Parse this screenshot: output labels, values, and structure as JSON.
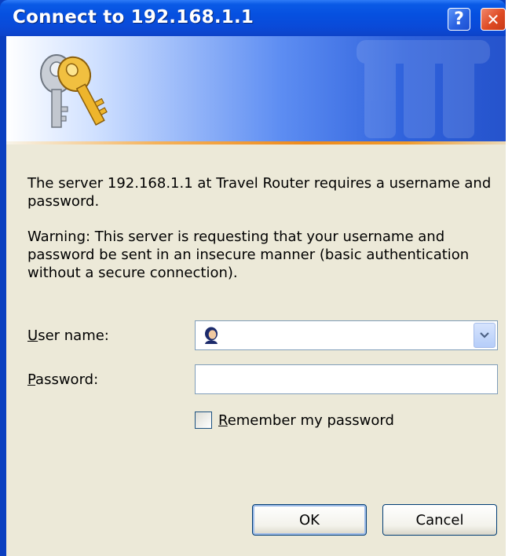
{
  "window": {
    "title": "Connect to 192.168.1.1",
    "help_glyph": "?",
    "close_glyph": "✕"
  },
  "banner": {
    "icon": "keys-icon",
    "watermark": "keys-watermark-icon"
  },
  "message": {
    "server_text": "The server 192.168.1.1 at Travel Router requires a username and password.",
    "warning_text": "Warning: This server is requesting that your username and password be sent in an insecure manner (basic authentication without a secure connection)."
  },
  "form": {
    "username_label_first": "U",
    "username_label_rest": "ser name:",
    "username_value": "",
    "password_label_first": "P",
    "password_label_rest": "assword:",
    "password_value": "",
    "remember_label_first": "R",
    "remember_label_rest": "emember my password",
    "remember_checked": false
  },
  "buttons": {
    "ok": "OK",
    "cancel": "Cancel"
  },
  "colors": {
    "titlebar": "#0a4ad8",
    "dialog_face": "#ece9d8",
    "accent_line": "#ee8a1c",
    "close_button": "#df4b24"
  }
}
